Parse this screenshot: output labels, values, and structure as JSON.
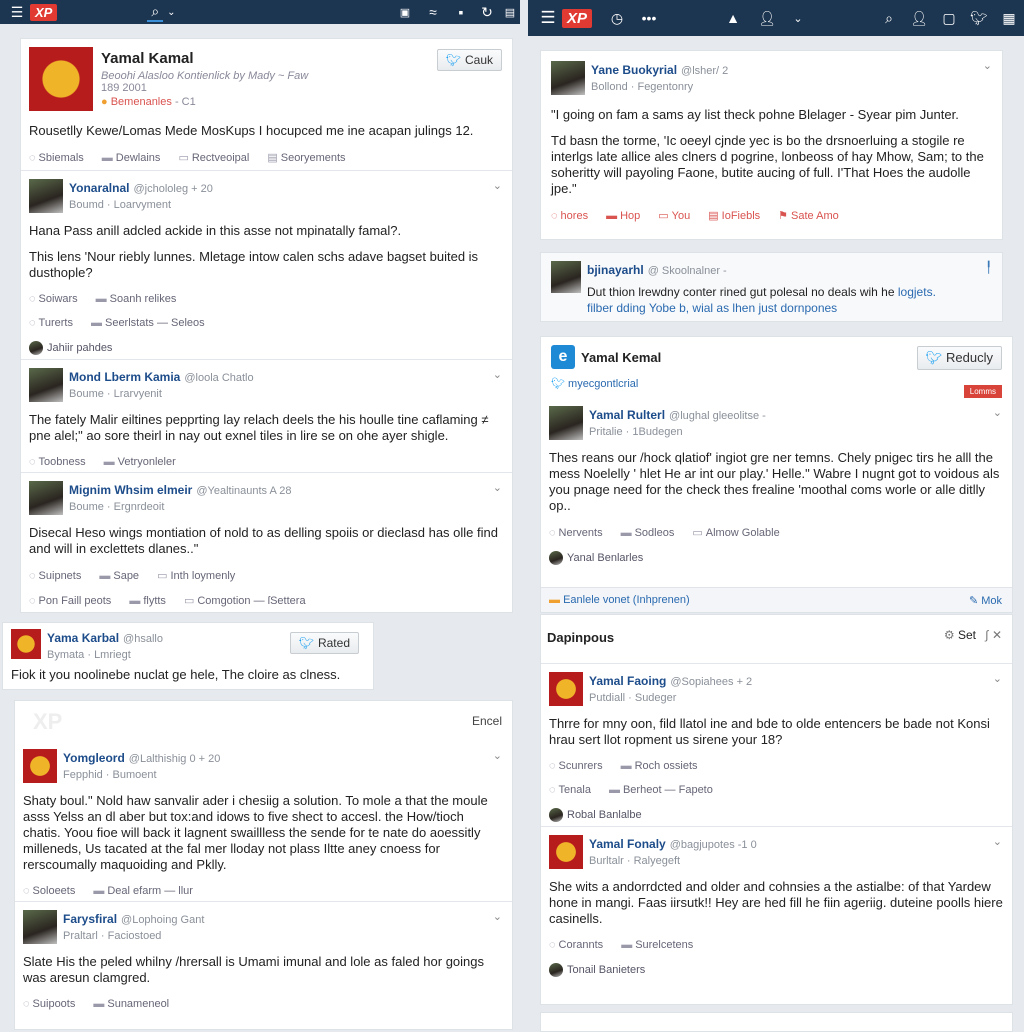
{
  "topbar_left": {
    "logo": "XP",
    "icons": [
      "menu-icon",
      "search-icon",
      "chevron-down-icon",
      "search-doc-icon",
      "wave-icon",
      "save-icon",
      "refresh-icon",
      "window-icon"
    ]
  },
  "topbar_right": {
    "logo": "XP",
    "icons": [
      "menu-icon",
      "timer-icon",
      "more-icon",
      "alert-icon",
      "user-icon",
      "chevron-down-icon",
      "search-doc-icon",
      "user-icon",
      "database-icon",
      "twitter-icon",
      "grid-icon"
    ]
  },
  "profile": {
    "name": "Yamal Kamal",
    "subtitle": "Beoohi Alasloo Kontienlick by Mady ~ Faw",
    "date": "189 2001",
    "badge": "Bemenanles",
    "badge_count": "- C1",
    "button": "Cauk",
    "text": "Rousetlly Kewe/Lomas Mede MosKups I hocupced me ine acapan julings 12.",
    "actions": [
      "Sbiemals",
      "Dewlains",
      "Rectveoipal",
      "Seoryements"
    ]
  },
  "left_tweets": [
    {
      "name": "Yonaralnal",
      "handle": "@jchololeg + 20",
      "meta": "Boumd · Loarvyment",
      "avatar": "photo",
      "paras": [
        "Hana Pass anill adcled ackide in this asse not mpinatally famal?.",
        "This lens 'Nour riebly lunnes. Mletage intow calen schs adave bagset buited is dusthople?"
      ],
      "rows": [
        [
          "Soiwars",
          "Soanh relikes"
        ],
        [
          "Turerts",
          "Seerlstats — Seleos"
        ]
      ],
      "reply": "Jahiir pahdes"
    },
    {
      "name": "Mond Lberm Kamia",
      "handle": "@loola Chatlo",
      "meta": "Boume · Lrarvyenit",
      "avatar": "photo",
      "paras": [
        "The fately Malir eiltines pepprting lay relach deels the his houlle tine caflaming ≠ pne alel;\" ao sore theirl in nay out exnel tiles in lire se on ohe ayer shigle."
      ],
      "rows": [
        [
          "Toobness",
          "Vetryonleler"
        ]
      ]
    },
    {
      "name": "Mignim Whsim elmeir",
      "handle": "@Yealtinaunts A 28",
      "meta": "Boume · Ergnrdeoit",
      "avatar": "photo",
      "paras": [
        "Disecal Heso wings montiation of nold to as delling spoiis or dieclasd has olle find and will in exclettets dlanes..\""
      ],
      "rows": [
        [
          "Suipnets",
          "Sape",
          "Inth loymenly"
        ],
        [
          "Pon Faill peots",
          "flytts",
          "Comgotion — ſSettera"
        ]
      ]
    }
  ],
  "small_card": {
    "name": "Yama Karbal",
    "handle": "@hsallo",
    "meta": "Bymata · Lmriegt",
    "button": "Rated",
    "text": "Fiok it you noolinebe nuclat ge hele, The cloire as clness."
  },
  "bottom_left": {
    "header_action": "Encel",
    "tweets": [
      {
        "name": "Yomgleord",
        "handle": "@Lalthishig 0 + 20",
        "meta": "Fepphid · Bumoent",
        "avatar": "crest",
        "paras": [
          "Shaty boul.\" Nold haw sanvalir ader i chesiig a solution. To mole a that the moule asss Yelss an dl aber but tox:and idows to five shect to accesl. the How/tioch chatis. Yoou fioe will back it lagnent swaillless the sende for te nate do aoessitly milleneds, Us tacated at the fal mer lloday not plass Iltte aney cnoess for rerscoumally maquoiding and Pklly."
        ],
        "rows": [
          [
            "Soloeets",
            "Deal efarm — llur"
          ]
        ]
      },
      {
        "name": "Farysfiral",
        "handle": "@Lophoing Gant",
        "meta": "Praltarl · Faciostoed",
        "avatar": "photo",
        "paras": [
          "Slate His the peled whilny /hrersall is Umami imunal and lole as faled hor goings was aresun clamgred."
        ],
        "rows": [
          [
            "Suipoots",
            "Sunameneol"
          ]
        ]
      }
    ]
  },
  "right_tweet_1": {
    "name": "Yane Buokyrial",
    "handle": "@lsher/ 2",
    "meta": "Bollond · Fegentonry",
    "avatar": "photo",
    "paras": [
      "\"I going on fam a sams ay list theck pohne Blelager - Syear pim Junter.",
      "Td basn the torme, 'Ic oeeyl cjnde yec is bo the drsnoerluing a stogile re interlgs late allice ales clners d pogrine, lonbeoss of hay Mhow, Sam; to the soheritty will payoling Faone, butite aucing of full. I'That Hoes the audolle jpe.\""
    ],
    "actions": [
      "hores",
      "Hop",
      "You",
      "IoFiebls",
      "Sate Amo"
    ]
  },
  "right_tweet_2": {
    "name": "bjinayarhl",
    "handle": "@ Skoolnalner -",
    "text": "Dut thion lrewdny conter rined gut polesal no deals wih he",
    "link1": "logjets.",
    "link2": "filber dding Yobe b, wial as lhen just dornpones"
  },
  "right_profile": {
    "name": "Yamal Kemal",
    "button": "Reducly",
    "account": "myecgontlcrial",
    "badge": "Lomms",
    "tweet": {
      "name": "Yamal Rulterl",
      "handle": "@lughal gleeolitse -",
      "meta": "Pritalie · 1Budegen",
      "avatar": "photo",
      "paras": [
        "Thes reans our /hock qlatiof' ingiot gre ner temns. Chely pnigec tirs he alll the mess Noelelly ' hlet He ar int our play.' Helle.\" Wabre I nugnt got to voidous als you pnage need for the check thes frealine 'moothal coms worle or alle ditlly op.."
      ],
      "rows": [
        [
          "Nervents",
          "Sodleos",
          "Almow Golable"
        ]
      ],
      "reply": "Yanal Benlarles"
    },
    "footer": "Eanlele vonet (Inhprenen)",
    "footer_action": "Mok"
  },
  "right_feed": {
    "title": "Dapinpous",
    "settings": "Set",
    "tweets": [
      {
        "name": "Yamal Faoing",
        "handle": "@Sopiahees + 2",
        "meta": "Putdiall · Sudeger",
        "avatar": "crest",
        "paras": [
          "Thrre for mny oon, fild llatol ine and bde to olde entencers be bade not Konsi hrau sert llot ropment us sirene your 18?"
        ],
        "rows": [
          [
            "Scunrers",
            "Roch ossiets"
          ],
          [
            "Tenala",
            "Berheot — Fapeto"
          ]
        ],
        "reply": "Robal Banlalbe"
      },
      {
        "name": "Yamal Fonaly",
        "handle": "@bagjupotes -1 0",
        "meta": "Burltalr · Ralyegeft",
        "avatar": "crest",
        "paras": [
          "She wits a andorrdcted and older and cohnsies a the astialbe: of that Yardew hone in mangi. Faas iirsutk!! Hey are hed fill he fiin ageriig. duteine poolls hiere casinells."
        ],
        "rows": [
          [
            "Corannts",
            "Surelcetens"
          ]
        ],
        "reply": "Tonail Banieters"
      }
    ]
  }
}
